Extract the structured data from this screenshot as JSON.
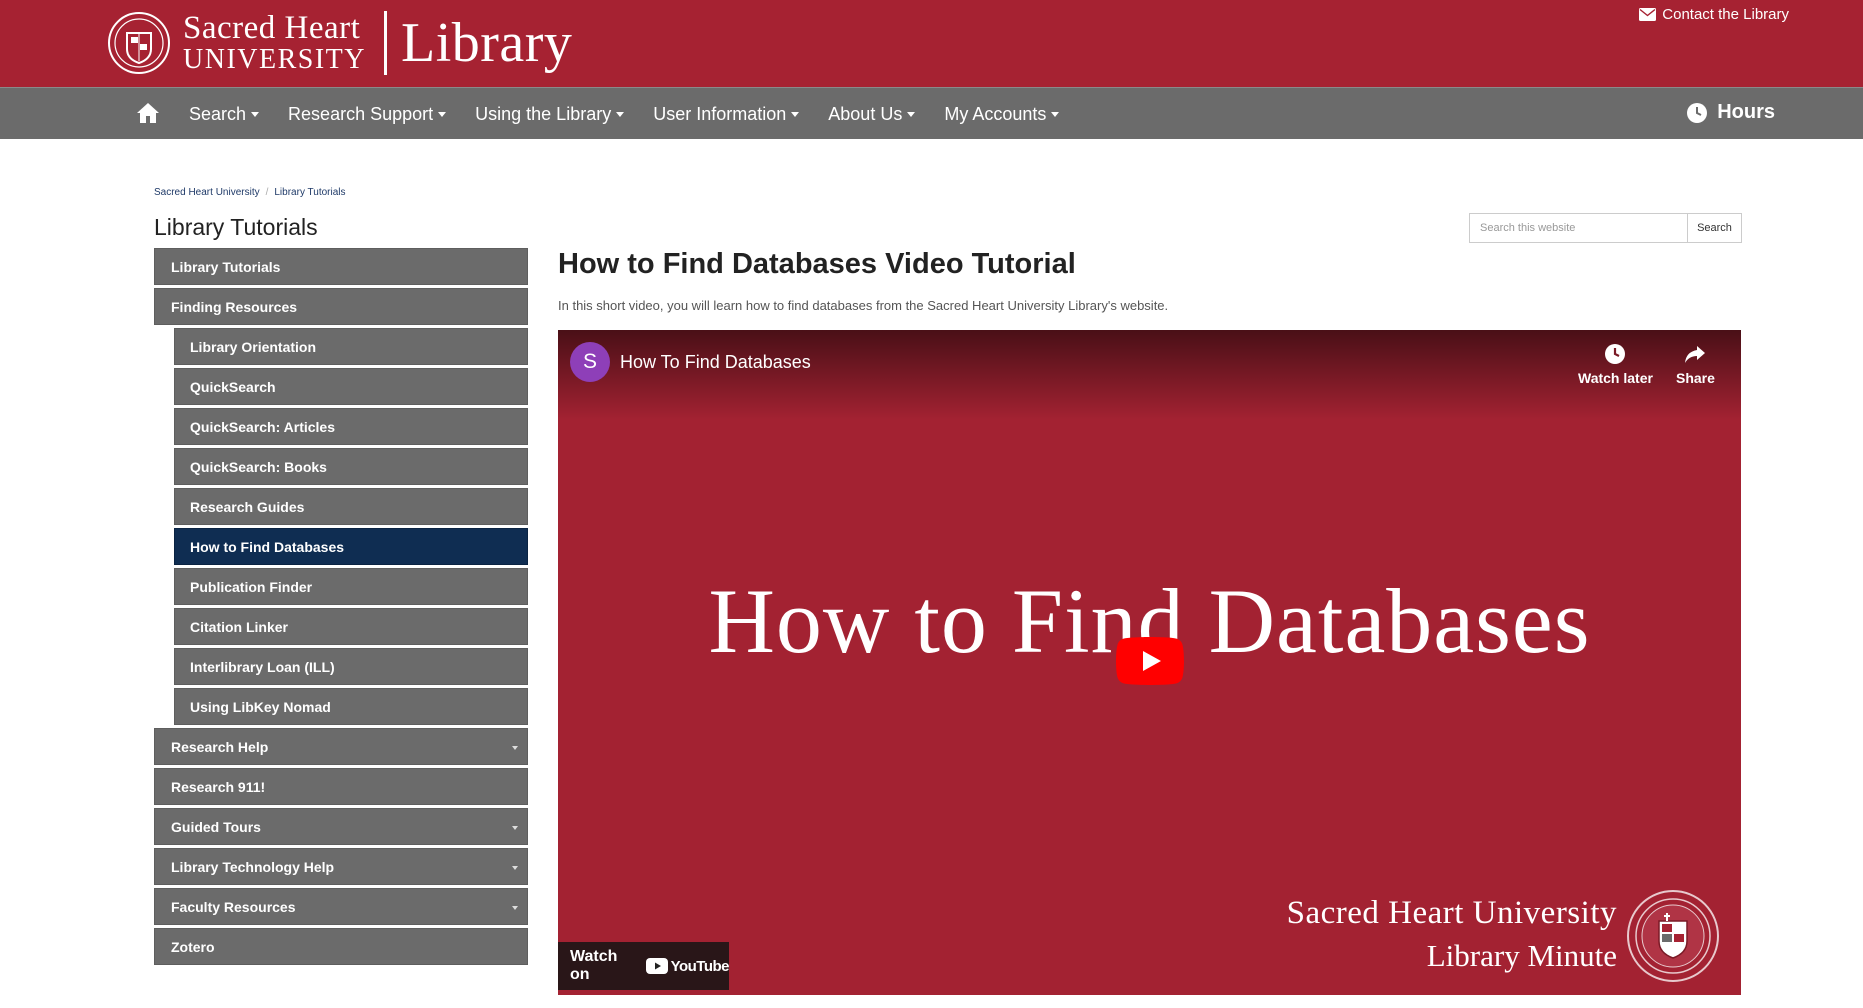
{
  "header": {
    "university_line1": "Sacred Heart",
    "university_line2": "UNIVERSITY",
    "library": "Library",
    "contact": "Contact the Library"
  },
  "nav": {
    "items": [
      {
        "label": "Search"
      },
      {
        "label": "Research Support"
      },
      {
        "label": "Using the Library"
      },
      {
        "label": "User Information"
      },
      {
        "label": "About Us"
      },
      {
        "label": "My Accounts"
      }
    ],
    "hours": "Hours"
  },
  "breadcrumb": [
    "Sacred Heart University",
    "Library Tutorials"
  ],
  "sidebar": {
    "title": "Library Tutorials",
    "items": [
      {
        "label": "Library Tutorials"
      },
      {
        "label": "Finding Resources"
      },
      {
        "label": "Library Orientation"
      },
      {
        "label": "QuickSearch"
      },
      {
        "label": "QuickSearch: Articles"
      },
      {
        "label": "QuickSearch: Books"
      },
      {
        "label": "Research Guides"
      },
      {
        "label": "How to Find Databases"
      },
      {
        "label": "Publication Finder"
      },
      {
        "label": "Citation Linker"
      },
      {
        "label": "Interlibrary Loan (ILL)"
      },
      {
        "label": "Using LibKey Nomad"
      },
      {
        "label": "Research Help"
      },
      {
        "label": "Research 911!"
      },
      {
        "label": "Guided Tours"
      },
      {
        "label": "Library Technology Help"
      },
      {
        "label": "Faculty Resources"
      },
      {
        "label": "Zotero"
      }
    ]
  },
  "search": {
    "placeholder": "Search this website",
    "button": "Search"
  },
  "main": {
    "title": "How to Find Databases Video Tutorial",
    "description": "In this short video, you will learn how to find databases from the Sacred Heart University Library's website."
  },
  "video": {
    "channel_initial": "S",
    "title": "How To Find Databases",
    "watch_later": "Watch later",
    "share": "Share",
    "big_text": "How to Find Databases",
    "brand_line1": "Sacred Heart University",
    "brand_line2": "Library Minute",
    "watch_on": "Watch on",
    "youtube": "YouTube"
  },
  "colors": {
    "brand_red": "#a62232",
    "nav_gray": "#6b6b6b",
    "active_navy": "#0f2d52"
  }
}
